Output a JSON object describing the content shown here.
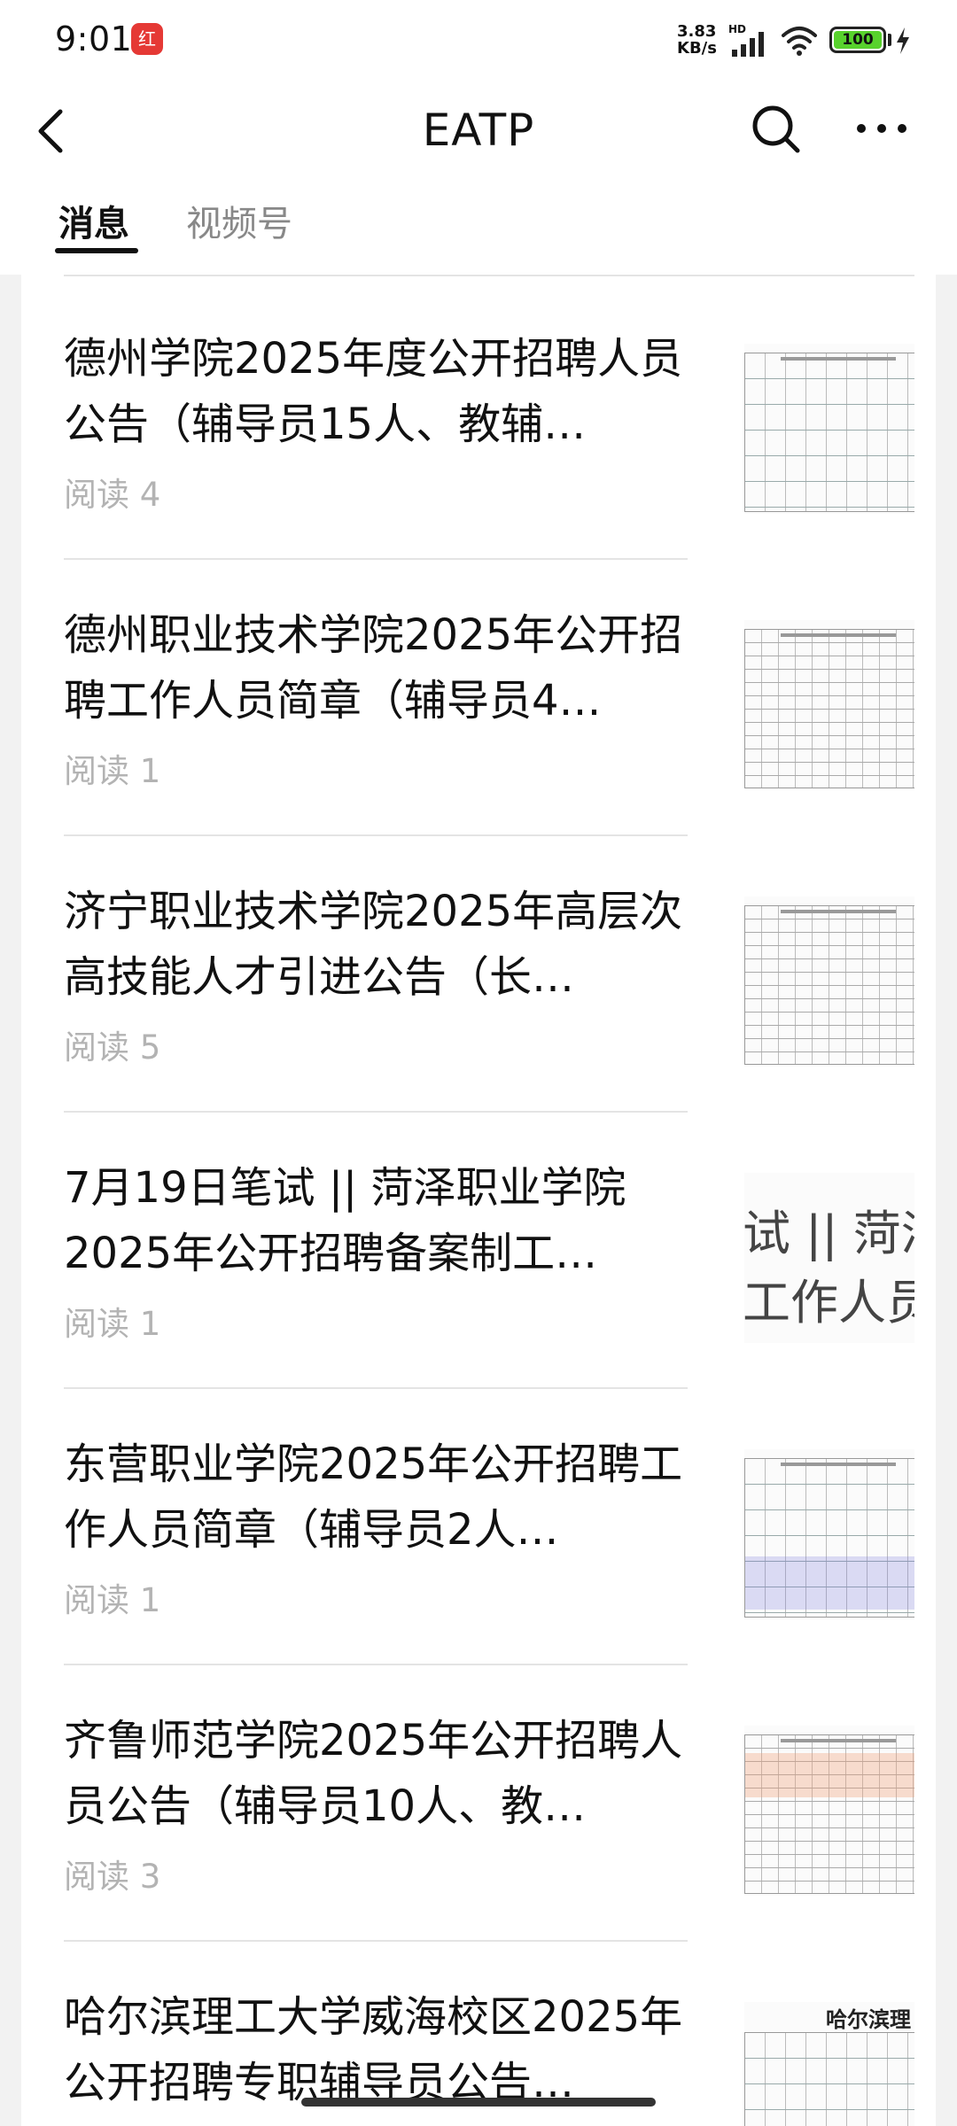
{
  "status_bar": {
    "time": "9:01",
    "app_badge_text": "红",
    "network_speed_value": "3.83",
    "network_speed_unit": "KB/s",
    "hd_label": "HD",
    "battery_level": "100"
  },
  "header": {
    "title": "EATP",
    "back_icon": "chevron-left-icon",
    "search_icon": "search-icon",
    "more_icon": "more-dots-icon"
  },
  "tabs": [
    {
      "label": "消息",
      "active": true
    },
    {
      "label": "视频号",
      "active": false
    }
  ],
  "articles": [
    {
      "title": "德州学院2025年度公开招聘人员公告（辅导员15人、教辅…",
      "reads": "阅读 4"
    },
    {
      "title": "德州职业技术学院2025年公开招聘工作人员简章（辅导员4…",
      "reads": "阅读 1"
    },
    {
      "title": "济宁职业技术学院2025年高层次高技能人才引进公告（长…",
      "reads": "阅读 5"
    },
    {
      "title": "7月19日笔试 || 菏泽职业学院2025年公开招聘备案制工…",
      "reads": "阅读 1",
      "thumb_text": "试 || 菏泽\n工作人员笔"
    },
    {
      "title": "东营职业学院2025年公开招聘工作人员简章（辅导员2人…",
      "reads": "阅读 1"
    },
    {
      "title": "齐鲁师范学院2025年公开招聘人员公告（辅导员10人、教…",
      "reads": "阅读 3"
    },
    {
      "title": "哈尔滨理工大学威海校区2025年公开招聘专职辅导员公告…",
      "reads": "",
      "thumb_heading": "哈尔滨理"
    }
  ]
}
